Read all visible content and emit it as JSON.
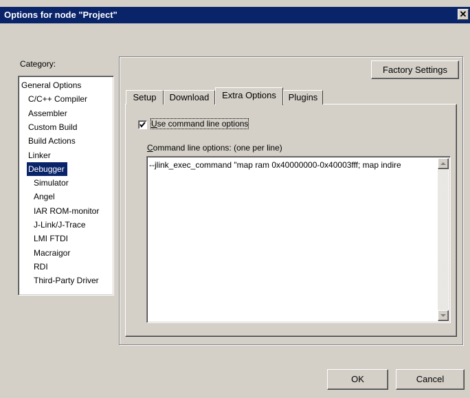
{
  "window": {
    "title": "Options for node \"Project\"",
    "close_glyph": "✕"
  },
  "category": {
    "label": "Category:",
    "items": [
      {
        "label": "General Options",
        "indent": 0,
        "selected": false
      },
      {
        "label": "C/C++ Compiler",
        "indent": 1,
        "selected": false
      },
      {
        "label": "Assembler",
        "indent": 1,
        "selected": false
      },
      {
        "label": "Custom Build",
        "indent": 1,
        "selected": false
      },
      {
        "label": "Build Actions",
        "indent": 1,
        "selected": false
      },
      {
        "label": "Linker",
        "indent": 1,
        "selected": false
      },
      {
        "label": "Debugger",
        "indent": 1,
        "selected": true
      },
      {
        "label": "Simulator",
        "indent": 2,
        "selected": false
      },
      {
        "label": "Angel",
        "indent": 2,
        "selected": false
      },
      {
        "label": "IAR ROM-monitor",
        "indent": 2,
        "selected": false
      },
      {
        "label": "J-Link/J-Trace",
        "indent": 2,
        "selected": false
      },
      {
        "label": "LMI FTDI",
        "indent": 2,
        "selected": false
      },
      {
        "label": "Macraigor",
        "indent": 2,
        "selected": false
      },
      {
        "label": "RDI",
        "indent": 2,
        "selected": false
      },
      {
        "label": "Third-Party Driver",
        "indent": 2,
        "selected": false
      }
    ]
  },
  "factory_settings_label": "Factory Settings",
  "tabs": [
    {
      "label": "Setup",
      "active": false
    },
    {
      "label": "Download",
      "active": false
    },
    {
      "label": "Extra Options",
      "active": true
    },
    {
      "label": "Plugins",
      "active": false
    }
  ],
  "extra_options": {
    "use_cmdline": {
      "checked": true,
      "mnemonic": "U",
      "rest": "se command line options"
    },
    "cmdline_label": {
      "mnemonic": "C",
      "rest": "ommand line options:  (one per line)"
    },
    "cmdline_value": "--jlink_exec_command \"map ram 0x40000000-0x40003fff; map indire"
  },
  "buttons": {
    "ok": "OK",
    "cancel": "Cancel"
  },
  "colors": {
    "titlebar": "#0a246a",
    "face": "#d4d0c8",
    "selection": "#0a246a"
  }
}
